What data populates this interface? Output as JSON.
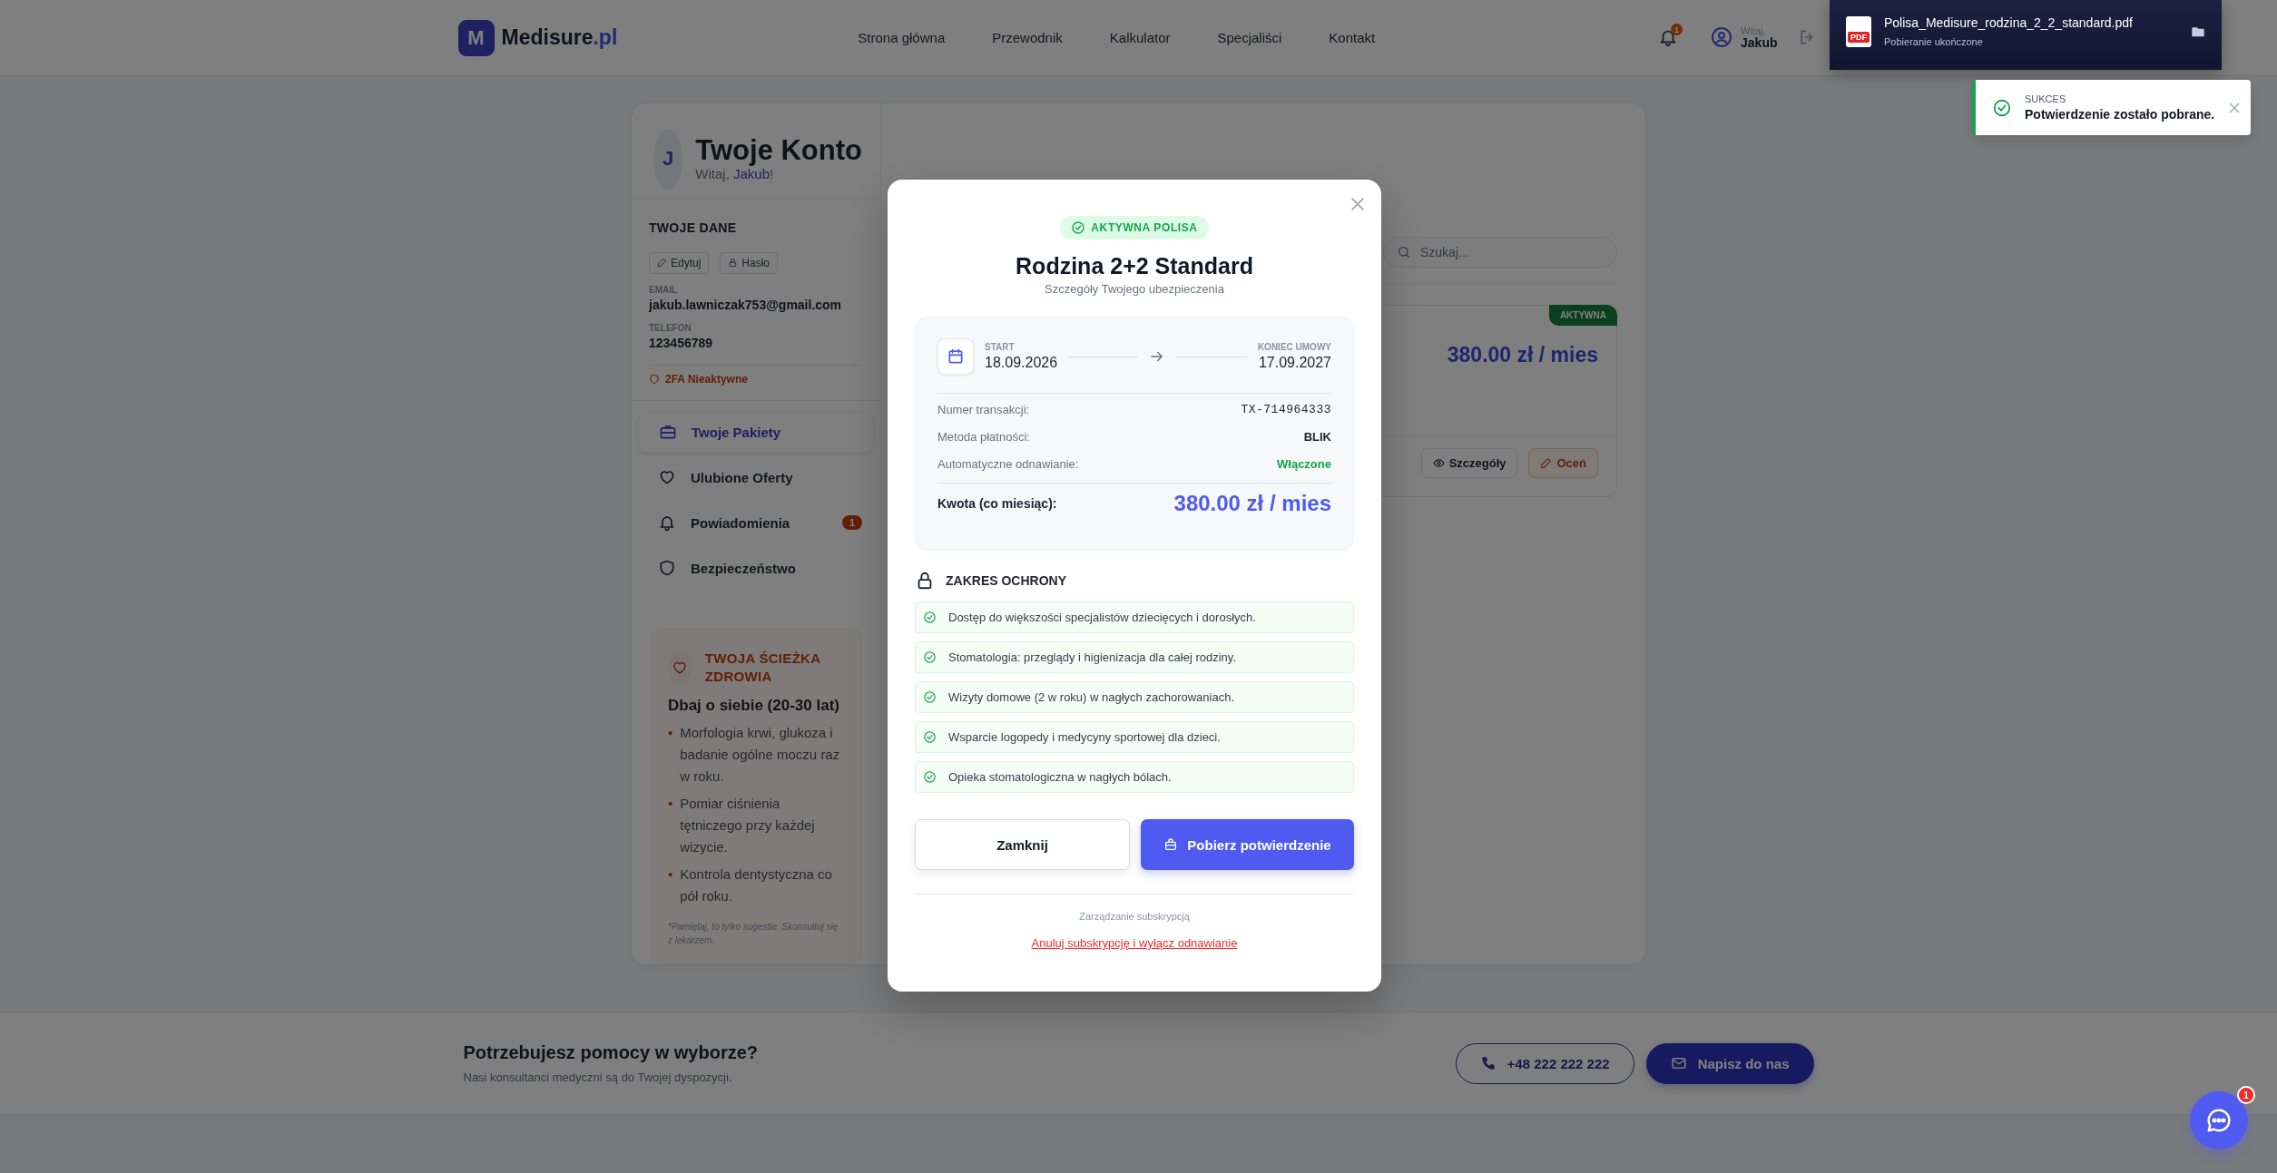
{
  "header": {
    "logo": {
      "mark": "M",
      "name": "Medisure",
      "suffix": ".pl"
    },
    "nav": [
      {
        "label": "Strona główna"
      },
      {
        "label": "Przewodnik"
      },
      {
        "label": "Kalkulator"
      },
      {
        "label": "Specjaliści"
      },
      {
        "label": "Kontakt"
      }
    ],
    "bell_badge": "1",
    "user": {
      "greeting": "Witaj,",
      "name": "Jakub"
    }
  },
  "account": {
    "avatar_initial": "J",
    "title": "Twoje Konto",
    "greeting": "Witaj, **Jakub**!"
  },
  "profile": {
    "heading": "TWOJE DANE",
    "buttons": [
      {
        "label": "Edytuj"
      },
      {
        "label": "Hasło"
      }
    ],
    "fields": [
      {
        "label": "EMAIL",
        "value": "jakub.lawniczak753@gmail.com"
      },
      {
        "label": "TELEFON",
        "value": "123456789"
      }
    ],
    "twofa": "2FA Nieaktywne"
  },
  "menu": [
    {
      "label": "Twoje Pakiety",
      "selected": true
    },
    {
      "label": "Ulubione Oferty",
      "selected": false
    },
    {
      "label": "Powiadomienia",
      "selected": false,
      "badge": "1"
    },
    {
      "label": "Bezpieczeństwo",
      "selected": false
    }
  ],
  "health": {
    "heading": "TWOJA ŚCIEŻKA ZDROWIA",
    "subtitle": "Dbaj o siebie (20-30 lat)",
    "marker": "•",
    "items": [
      "Morfologia krwi, glukoza i badanie ogólne moczu raz w roku.",
      "Pomiar ciśnienia tętniczego przy każdej wizycie.",
      "Kontrola dentystyczna co pół roku."
    ],
    "note": "*Pamiętaj, to tylko sugestie. Skonsultuj się z lekarzem."
  },
  "main": {
    "search": {
      "placeholder": "Szukaj..."
    },
    "package": {
      "status": "AKTYWNA",
      "price": "380.00 zł / mies",
      "buttons": [
        {
          "kind": "details",
          "label": "Szczegóły"
        },
        {
          "kind": "rate",
          "label": "Oceń"
        }
      ]
    }
  },
  "footer": {
    "title": "Potrzebujesz pomocy w wyborze?",
    "subtitle": "Nasi konsultanci medyczni są do Twojej dyspozycji.",
    "phone": "+48 222 222 222",
    "write": "Napisz do nas"
  },
  "modal": {
    "badge": "AKTYWNA POLISA",
    "title": "Rodzina 2+2 Standard",
    "subtitle": "Szczegóły Twojego ubezpieczenia",
    "start": {
      "label": "START",
      "date": "18.09.2026"
    },
    "end": {
      "label": "KONIEC UMOWY",
      "date": "17.09.2027"
    },
    "details": [
      {
        "kind": "mono",
        "label": "Numer transakcji:",
        "value": "TX-714964333"
      },
      {
        "kind": "plain",
        "label": "Metoda płatności:",
        "value": "BLIK"
      },
      {
        "kind": "positive",
        "label": "Automatyczne odnawianie:",
        "value": "Włączone"
      }
    ],
    "amount": {
      "label": "Kwota (co miesiąc):",
      "value": "380.00 zł / mies"
    },
    "coverage": {
      "heading": "ZAKRES OCHRONY",
      "items": [
        "Dostęp do większości specjalistów dziecięcych i dorosłych.",
        "Stomatologia: przeglądy i higienizacja dla całej rodziny.",
        "Wizyty domowe (2 w roku) w nagłych zachorowaniach.",
        "Wsparcie logopedy i medycyny sportowej dla dzieci.",
        "Opieka stomatologiczna w nagłych bólach."
      ]
    },
    "close_button": "Zamknij",
    "download_button": "Pobierz potwierdzenie",
    "manage_label": "Zarządzanie subskrypcją",
    "cancel_link": "Anuluj subskrypcję i wyłącz odnawianie"
  },
  "toasts": [
    {
      "kind": "download",
      "file_type": "PDF",
      "title": "Polisa_Medisure_rodzina_2_2_standard.pdf",
      "message": "Pobieranie ukończone"
    },
    {
      "kind": "success",
      "title": "SUKCES",
      "message": "Potwierdzenie zostało pobrane."
    }
  ],
  "chat": {
    "badge": "1"
  }
}
